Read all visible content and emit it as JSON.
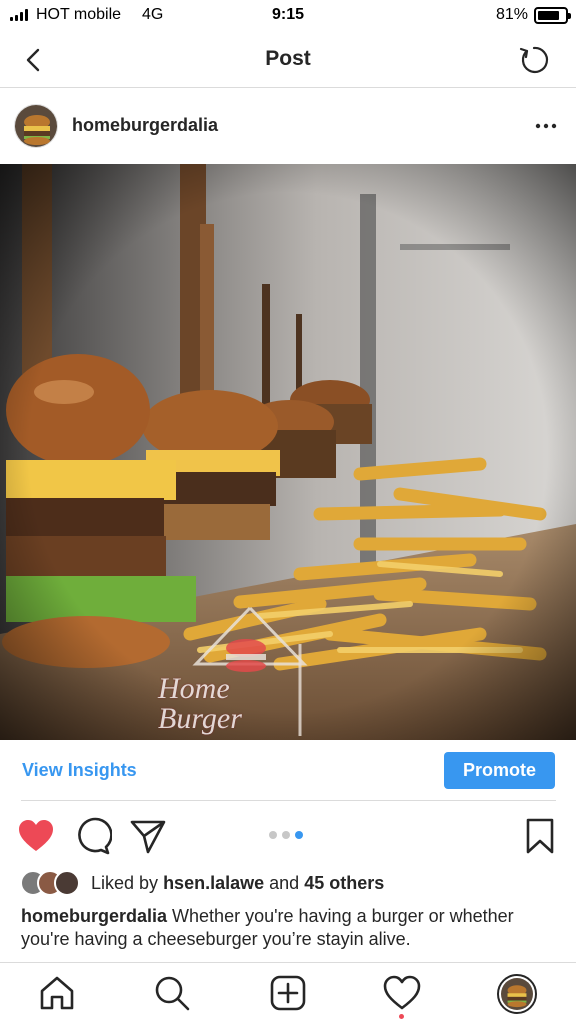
{
  "status_bar": {
    "carrier": "HOT mobile",
    "network": "4G",
    "time": "9:15",
    "battery_percent": "81%",
    "battery_level": 0.81
  },
  "nav": {
    "title": "Post",
    "back_icon": "chevron-left-icon",
    "refresh_icon": "refresh-icon"
  },
  "post": {
    "username": "homeburgerdalia",
    "more_icon": "ellipsis-icon",
    "image_watermark": "Home Burger",
    "carousel": {
      "count": 3,
      "active_index": 2
    }
  },
  "insights": {
    "view_insights_label": "View Insights",
    "promote_label": "Promote"
  },
  "actions": {
    "like_icon": "heart-filled-icon",
    "comment_icon": "comment-icon",
    "share_icon": "send-icon",
    "save_icon": "bookmark-icon"
  },
  "likes": {
    "prefix": "Liked by",
    "user": "hsen.lalawe",
    "connector": "and",
    "others": "45 others"
  },
  "caption": {
    "username": "homeburgerdalia",
    "text": "Whether you're having a burger or whether you're having a cheeseburger you’re stayin alive."
  },
  "tabbar": {
    "items": [
      "home-icon",
      "search-icon",
      "new-post-icon",
      "activity-heart-icon",
      "profile-avatar"
    ]
  },
  "colors": {
    "accent": "#3897f0",
    "like_red": "#ed4956",
    "text": "#262626",
    "divider": "#dbdbdb"
  }
}
